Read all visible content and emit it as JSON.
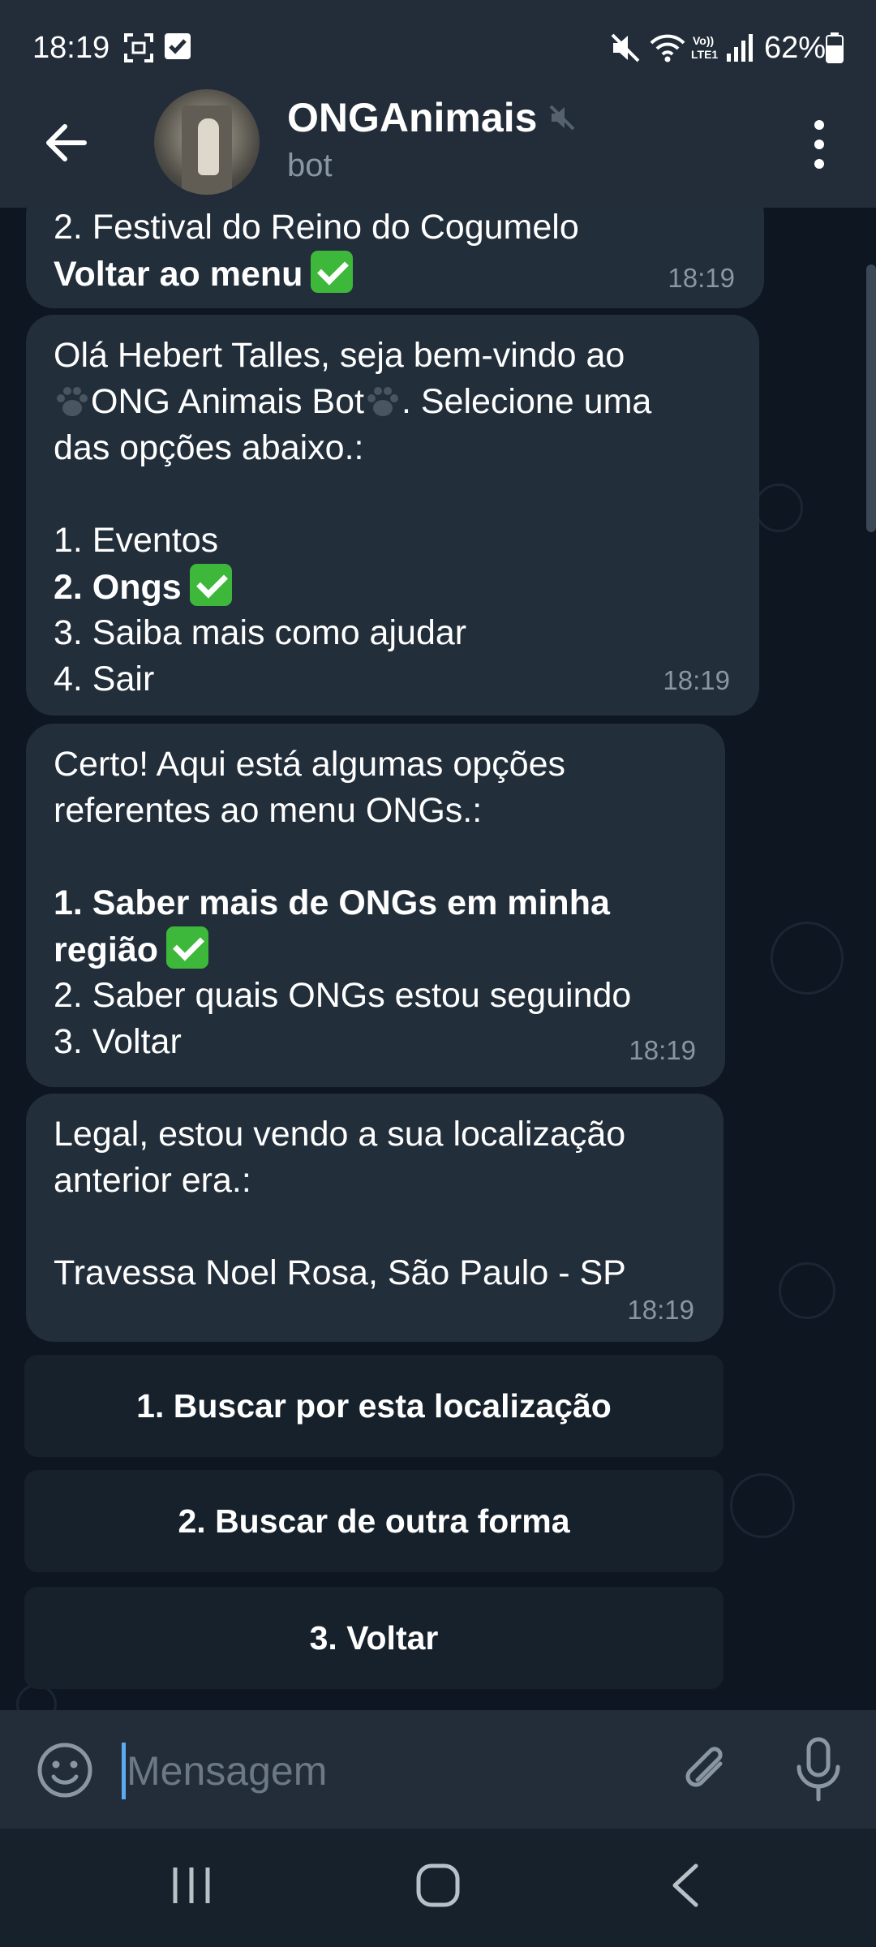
{
  "status_bar": {
    "time": "18:19",
    "battery": "62%",
    "icons": [
      "screenshot-icon",
      "check-square-icon",
      "mute-icon",
      "wifi-icon",
      "volte-icon",
      "signal-icon",
      "battery-icon"
    ],
    "volte_text": "Vo)) LTE1"
  },
  "header": {
    "title": "ONGAnimais",
    "subtitle": "bot"
  },
  "messages": [
    {
      "lines": [
        {
          "text": "2. Festival do Reino do Cogumelo",
          "bold": false
        },
        {
          "text": "Voltar ao menu",
          "bold": true,
          "check": true
        }
      ],
      "time": "18:19"
    },
    {
      "lines": [
        {
          "text": "Olá Hebert Talles, seja bem-vindo ao",
          "bold": false
        },
        {
          "pre": "ONG Animais Bot",
          "post": ". Selecione uma",
          "paws": true
        },
        {
          "text": "das opções abaixo.:",
          "bold": false
        },
        {
          "gap": true
        },
        {
          "text": "1. Eventos",
          "bold": false
        },
        {
          "text": "2. Ongs",
          "bold": true,
          "check": true
        },
        {
          "text": "3. Saiba mais como ajudar",
          "bold": false
        },
        {
          "text": "4. Sair",
          "bold": false
        }
      ],
      "time": "18:19"
    },
    {
      "lines": [
        {
          "text": "Certo! Aqui está algumas opções",
          "bold": false
        },
        {
          "text": "referentes ao menu ONGs.:",
          "bold": false
        },
        {
          "gap": true
        },
        {
          "text": "1. Saber mais de ONGs em minha",
          "bold": true
        },
        {
          "text": "região",
          "bold": true,
          "check": true
        },
        {
          "text": "2. Saber quais ONGs estou seguindo",
          "bold": false
        },
        {
          "text": "3. Voltar",
          "bold": false
        }
      ],
      "time": "18:19"
    },
    {
      "lines": [
        {
          "text": "Legal, estou vendo a sua localização",
          "bold": false
        },
        {
          "text": "anterior era.:",
          "bold": false
        },
        {
          "gap": true
        },
        {
          "text": "Travessa Noel Rosa, São Paulo - SP",
          "bold": false
        }
      ],
      "time": "18:19"
    }
  ],
  "keyboard_buttons": [
    "1. Buscar por esta localização",
    "2. Buscar de outra forma",
    "3. Voltar"
  ],
  "input": {
    "placeholder": "Mensagem"
  },
  "colors": {
    "header_bg": "#222d39",
    "chat_bg": "#0e1621",
    "bubble_bg": "#222e3a",
    "check_green": "#3db83a",
    "accent_blue": "#5fa9f0"
  }
}
